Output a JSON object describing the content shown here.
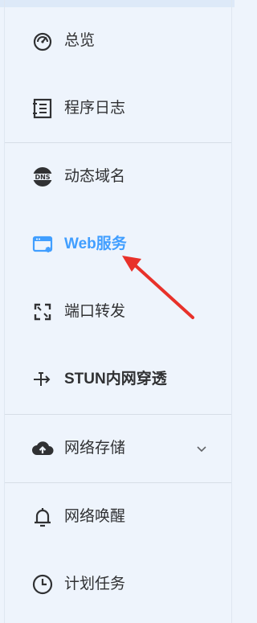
{
  "menu": {
    "overview": "总览",
    "logs": "程序日志",
    "ddns": "动态域名",
    "web_service": "Web服务",
    "port_forward": "端口转发",
    "stun": "STUN内网穿透",
    "network_storage": "网络存储",
    "wake_on_lan": "网络唤醒",
    "scheduled_tasks": "计划任务"
  },
  "colors": {
    "active": "#409eff",
    "text": "#303133",
    "annotation_arrow": "#e8312a"
  },
  "icons": [
    "dashboard-icon",
    "log-icon",
    "dns-icon",
    "web-service-icon",
    "port-forward-icon",
    "stun-icon",
    "cloud-upload-icon",
    "bell-icon",
    "clock-icon"
  ]
}
